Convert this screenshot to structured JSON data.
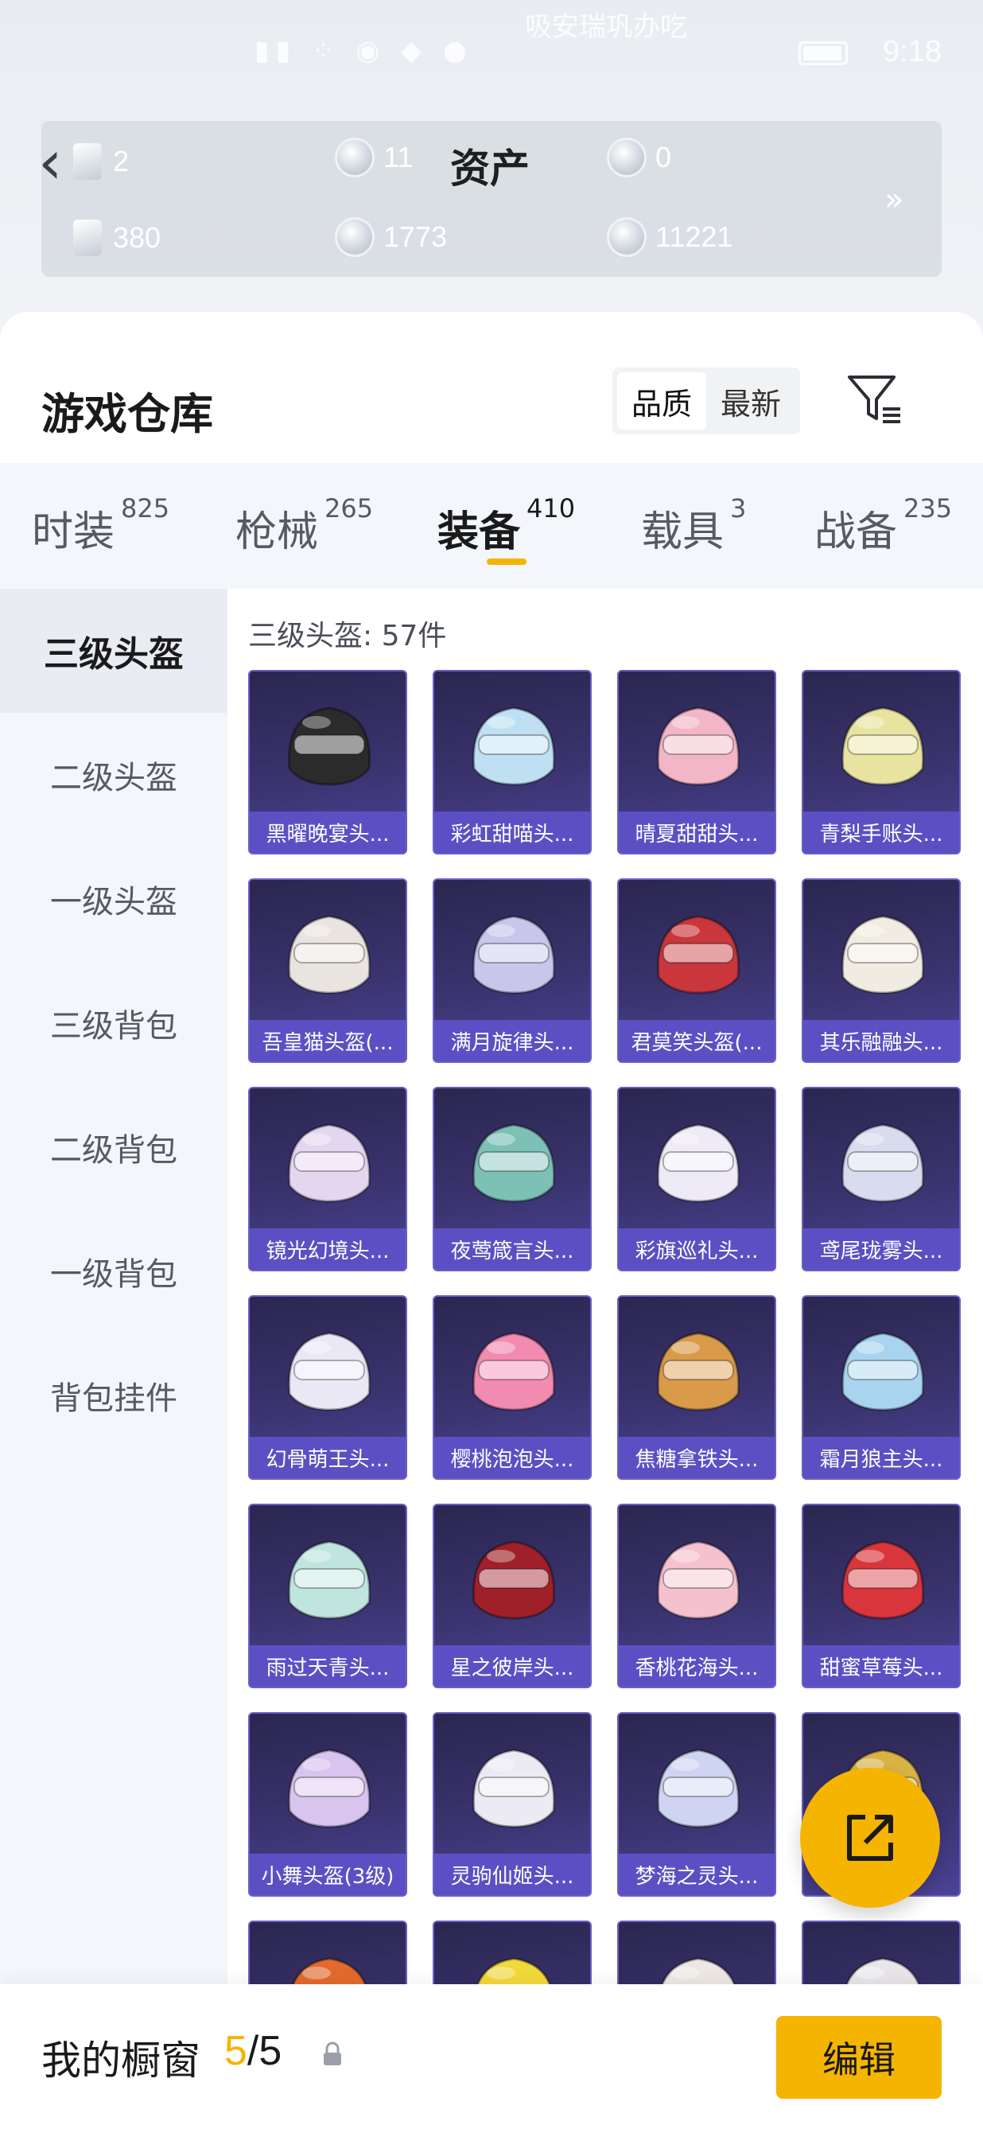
{
  "status_bar": {
    "time": "9:18",
    "notice": "吸安瑞巩办吃"
  },
  "assets": {
    "title": "资产",
    "row1": [
      "2",
      "11",
      "0"
    ],
    "row2": [
      "380",
      "1773",
      "11221"
    ],
    "more": "»"
  },
  "warehouse": {
    "title": "游戏仓库",
    "sort_options": [
      "品质",
      "最新"
    ],
    "active_sort": "品质"
  },
  "categories": [
    {
      "label": "时装",
      "count": "825"
    },
    {
      "label": "枪械",
      "count": "265"
    },
    {
      "label": "装备",
      "count": "410",
      "active": true
    },
    {
      "label": "载具",
      "count": "3"
    },
    {
      "label": "战备",
      "count": "235"
    }
  ],
  "sidebar": {
    "items": [
      "三级头盔",
      "二级头盔",
      "一级头盔",
      "三级背包",
      "二级背包",
      "一级背包",
      "背包挂件"
    ],
    "active": "三级头盔"
  },
  "content": {
    "title": "三级头盔: 57件"
  },
  "items": [
    {
      "name": "黑曜晚宴头...",
      "color": "#2b2b2b"
    },
    {
      "name": "彩虹甜喵头...",
      "color": "#bfe0f2"
    },
    {
      "name": "晴夏甜甜头...",
      "color": "#f3b6c8"
    },
    {
      "name": "青梨手账头...",
      "color": "#e8e4a0"
    },
    {
      "name": "吾皇猫头盔(...",
      "color": "#e9e4e0"
    },
    {
      "name": "满月旋律头...",
      "color": "#c8c6ea"
    },
    {
      "name": "君莫笑头盔(...",
      "color": "#c9363c"
    },
    {
      "name": "其乐融融头...",
      "color": "#f1ece2"
    },
    {
      "name": "镜光幻境头...",
      "color": "#e4d6ef"
    },
    {
      "name": "夜莺箴言头...",
      "color": "#7cc0b6"
    },
    {
      "name": "彩旗巡礼头...",
      "color": "#eeeaf6"
    },
    {
      "name": "鸢尾珑雾头...",
      "color": "#d8dcee"
    },
    {
      "name": "幻骨萌王头...",
      "color": "#ebe8f5"
    },
    {
      "name": "樱桃泡泡头...",
      "color": "#f28bb0"
    },
    {
      "name": "焦糖拿铁头...",
      "color": "#d99b4a"
    },
    {
      "name": "霜月狼主头...",
      "color": "#a9d4ef"
    },
    {
      "name": "雨过天青头...",
      "color": "#bfe5de"
    },
    {
      "name": "星之彼岸头...",
      "color": "#a0202a"
    },
    {
      "name": "香桃花海头...",
      "color": "#f4c2cf"
    },
    {
      "name": "甜蜜草莓头...",
      "color": "#d8353c"
    },
    {
      "name": "小舞头盔(3级)",
      "color": "#d9c3ef"
    },
    {
      "name": "灵驹仙姬头...",
      "color": "#eceaf2"
    },
    {
      "name": "梦海之灵头...",
      "color": "#cfd4f2"
    },
    {
      "name": "",
      "color": "#d9b445"
    },
    {
      "name": "",
      "color": "#e46a2c"
    },
    {
      "name": "",
      "color": "#f2d93a"
    },
    {
      "name": "",
      "color": "#ede8e4"
    },
    {
      "name": "",
      "color": "#e9e6ea"
    }
  ],
  "showcase": {
    "label": "我的橱窗",
    "current": "5",
    "total": "/5",
    "edit_label": "编辑"
  },
  "accent_color": "#f5b400",
  "tile_label_color": "#5b50c3"
}
